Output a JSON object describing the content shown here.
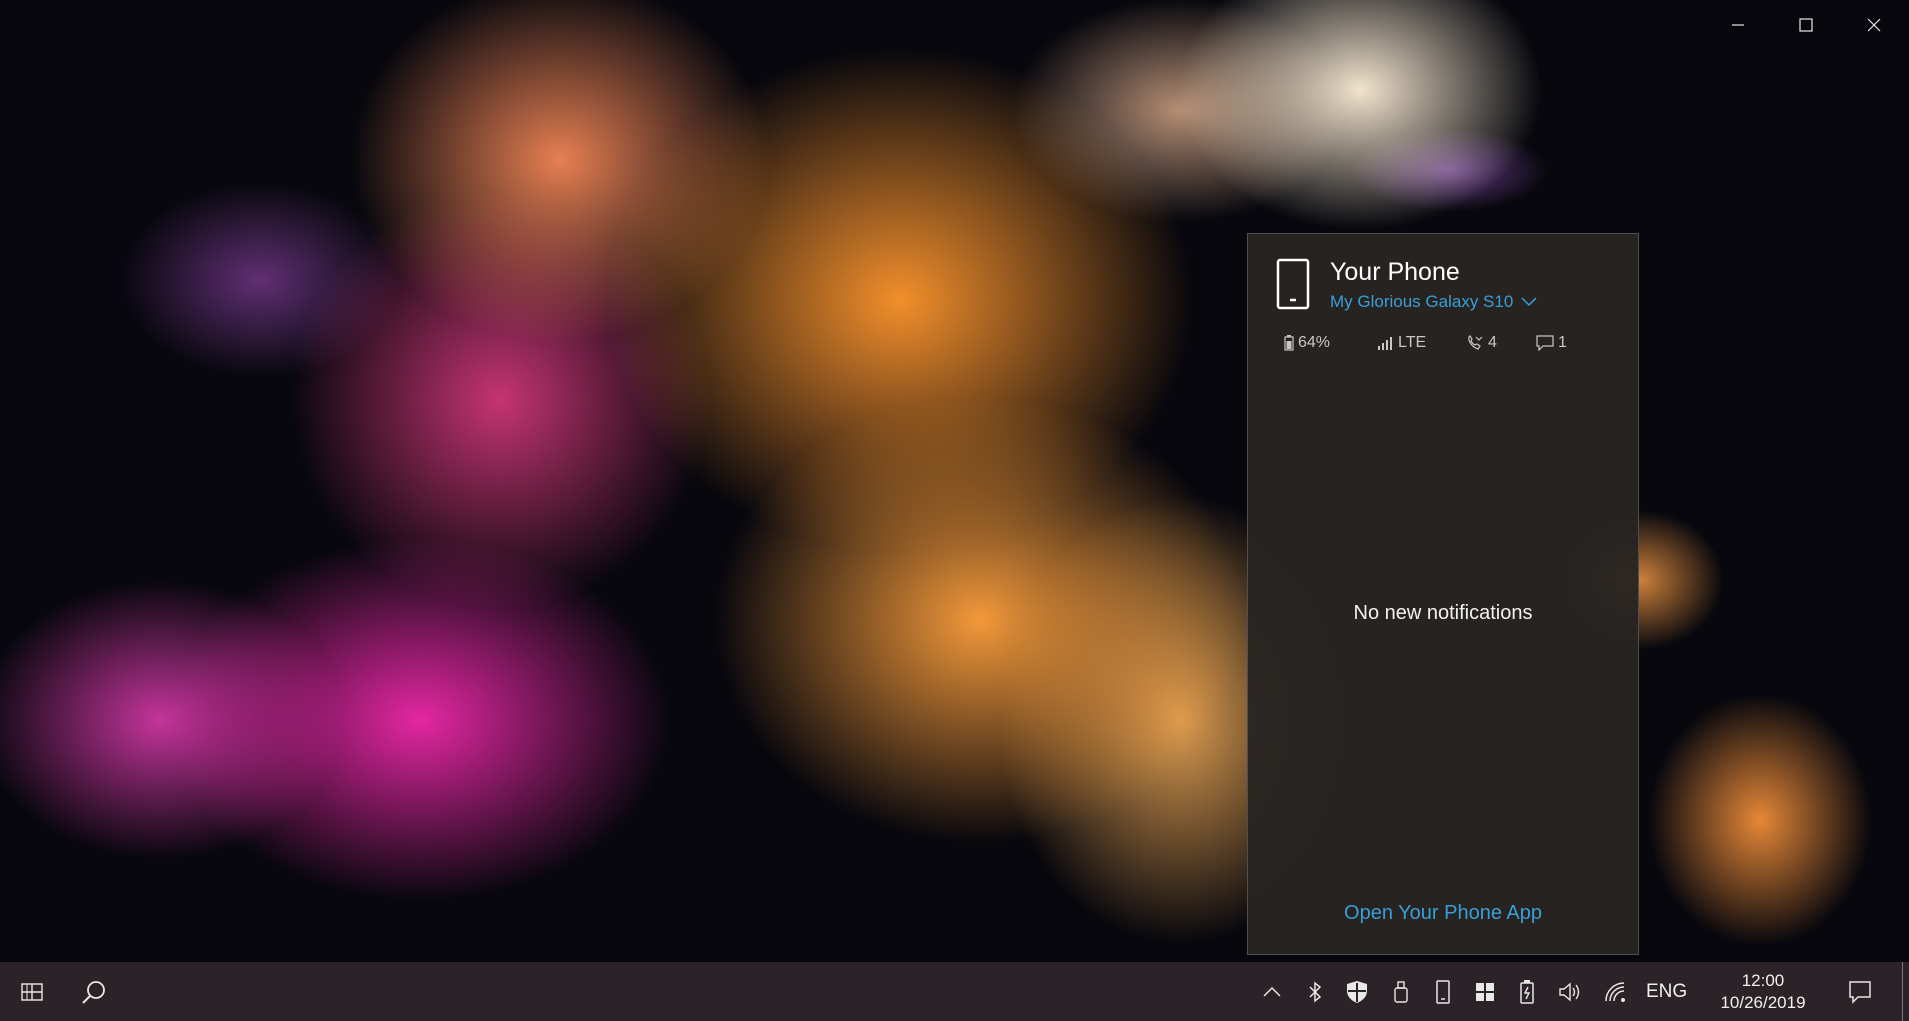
{
  "window": {
    "minimize_icon": "minimize-icon",
    "maximize_icon": "maximize-icon",
    "close_icon": "close-icon"
  },
  "flyout": {
    "title": "Your Phone",
    "device_name": "My Glorious Galaxy S10",
    "status": {
      "battery": "64%",
      "signal": "LTE",
      "calls": "4",
      "messages": "1"
    },
    "empty_message": "No new notifications",
    "open_app_link": "Open Your Phone App",
    "accent_color": "#3a9fd8"
  },
  "taskbar": {
    "icons": [
      "start-icon",
      "search-icon"
    ],
    "tray_icons": [
      "chevron-up-icon",
      "bluetooth-icon",
      "defender-shield-icon",
      "usb-icon",
      "phone-icon",
      "windows-icon",
      "phone-battery-icon",
      "volume-icon",
      "wifi-icon"
    ],
    "language": "ENG",
    "time": "12:00",
    "date": "10/26/2019",
    "notification_icon": "action-center-icon"
  }
}
